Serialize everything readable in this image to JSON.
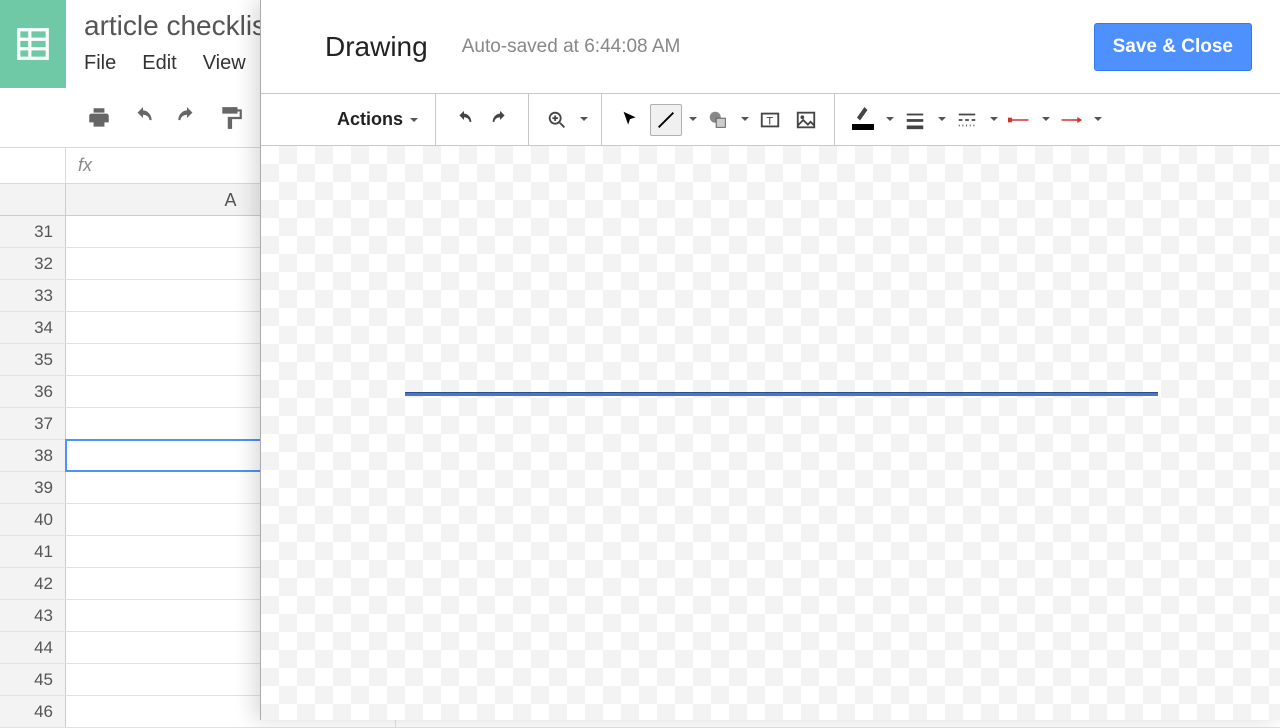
{
  "sheets": {
    "doc_title": "article checklis",
    "menus": {
      "file": "File",
      "edit": "Edit",
      "view": "View"
    },
    "fx_label": "fx",
    "columns": {
      "a": "A"
    },
    "rows": [
      31,
      32,
      33,
      34,
      35,
      36,
      37,
      38,
      39,
      40,
      41,
      42,
      43,
      44,
      45,
      46
    ],
    "selected_row": 38
  },
  "drawing": {
    "title": "Drawing",
    "autosave": "Auto-saved at 6:44:08 AM",
    "save_close": "Save & Close",
    "actions_label": "Actions",
    "line_color": "#000000",
    "drawn_object_color": "#4a77c4"
  }
}
